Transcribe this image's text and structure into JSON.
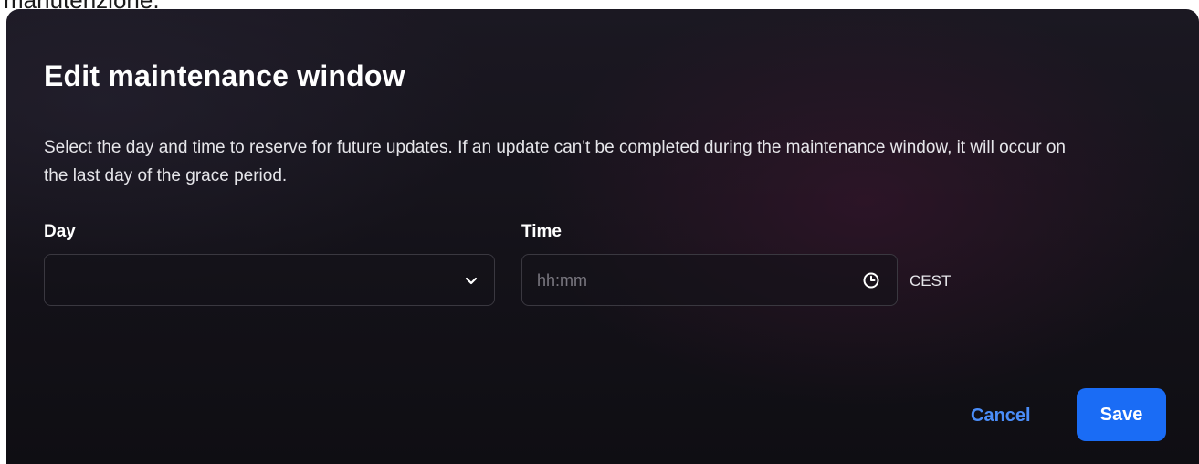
{
  "page": {
    "top_text": "manutenzione."
  },
  "dialog": {
    "title": "Edit maintenance window",
    "description": "Select the day and time to reserve for future updates. If an update can't be completed during the maintenance window, it will occur on the last day of the grace period.",
    "day_field": {
      "label": "Day",
      "value": "",
      "icon": "chevron-down-icon"
    },
    "time_field": {
      "label": "Time",
      "value": "",
      "placeholder": "hh:mm",
      "icon": "clock-icon",
      "timezone": "CEST"
    },
    "actions": {
      "cancel_label": "Cancel",
      "save_label": "Save"
    },
    "colors": {
      "accent": "#1a6cf5",
      "link": "#4a8df8",
      "background": "#141219"
    }
  }
}
